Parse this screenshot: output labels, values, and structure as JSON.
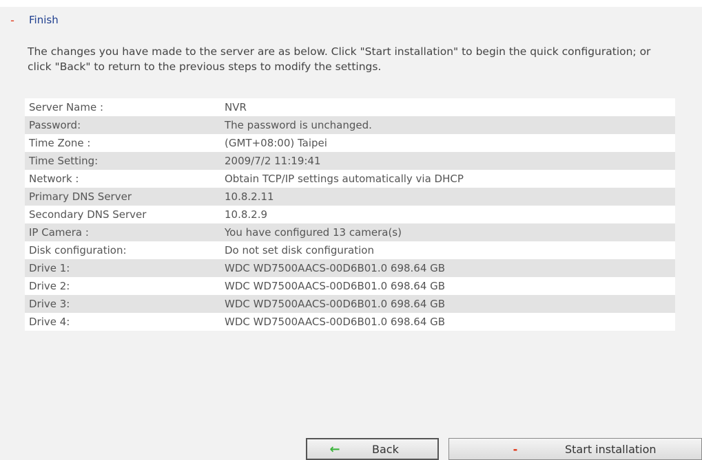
{
  "section": {
    "toggle": "-",
    "title": "Finish"
  },
  "intro_text": "The changes you have made to the server are as below. Click \"Start installation\" to begin the quick configuration; or click \"Back\" to return to the previous steps to modify the settings.",
  "summary": [
    {
      "label": "Server Name :",
      "value": "NVR"
    },
    {
      "label": "Password:",
      "value": "The password is unchanged."
    },
    {
      "label": "Time Zone :",
      "value": "(GMT+08:00) Taipei"
    },
    {
      "label": "Time Setting:",
      "value": "2009/7/2 11:19:41"
    },
    {
      "label": "Network :",
      "value": "Obtain TCP/IP settings automatically via DHCP"
    },
    {
      "label": "Primary DNS Server",
      "value": "10.8.2.11"
    },
    {
      "label": "Secondary DNS Server",
      "value": "10.8.2.9"
    },
    {
      "label": "IP Camera :",
      "value": "You have configured 13 camera(s)"
    },
    {
      "label": "Disk configuration:",
      "value": "Do not set disk configuration"
    },
    {
      "label": "Drive 1:",
      "value": "WDC WD7500AACS-00D6B01.0 698.64 GB"
    },
    {
      "label": "Drive 2:",
      "value": "WDC WD7500AACS-00D6B01.0 698.64 GB"
    },
    {
      "label": "Drive 3:",
      "value": "WDC WD7500AACS-00D6B01.0 698.64 GB"
    },
    {
      "label": "Drive 4:",
      "value": "WDC WD7500AACS-00D6B01.0 698.64 GB"
    }
  ],
  "buttons": {
    "back": {
      "label": "Back",
      "icon": "left-arrow-icon",
      "icon_glyph": "←",
      "icon_color": "#3cb43c"
    },
    "start": {
      "label": "Start installation",
      "icon": "minus-icon",
      "icon_glyph": "-",
      "icon_color": "#e03010"
    }
  },
  "colors": {
    "background": "#f2f2f2",
    "row_alt": "#e3e3e3",
    "title": "#1f3f8f",
    "toggle": "#e03010"
  }
}
